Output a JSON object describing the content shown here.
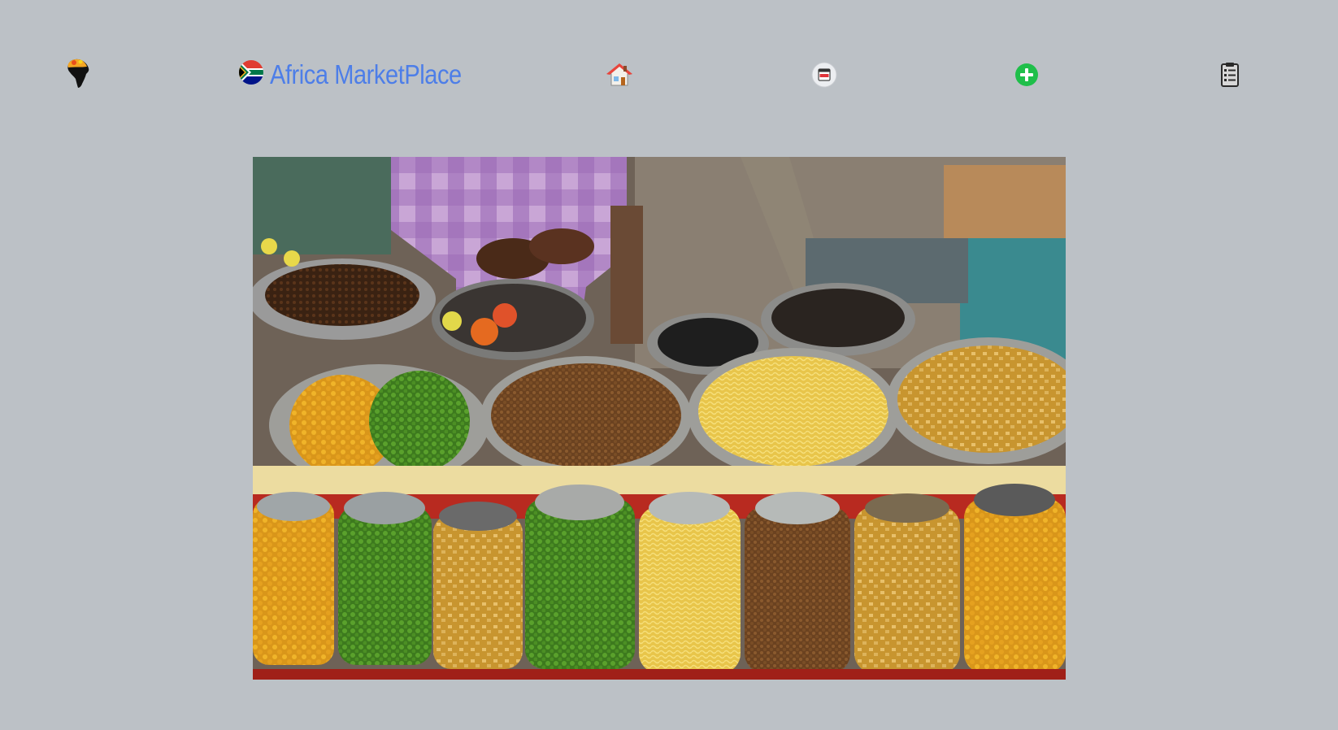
{
  "header": {
    "logo_icon": "africa-continent-logo-icon",
    "brand_flag_icon": "south-africa-flag-icon",
    "brand_title": "Africa MarketPlace",
    "brand_color": "#4d7ee8",
    "nav": [
      {
        "icon": "home-icon"
      },
      {
        "icon": "sell-card-icon"
      },
      {
        "icon": "add-circle-icon",
        "color": "#1fbf4a"
      },
      {
        "icon": "list-document-icon"
      }
    ]
  },
  "hero": {
    "image_subject": "market-stall-grains-jars"
  },
  "colors": {
    "background": "#bcc1c6"
  }
}
